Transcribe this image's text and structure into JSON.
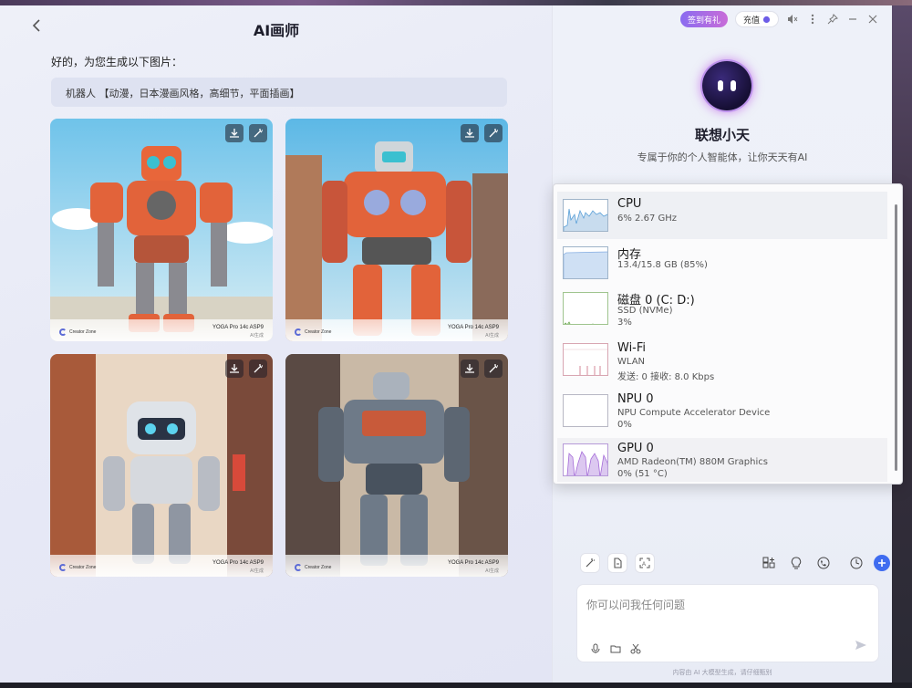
{
  "left": {
    "title": "AI画师",
    "reply": "好的，为您生成以下图片：",
    "prompt": "机器人 【动漫，日本漫画风格，高细节，平面插画】",
    "images": [
      {
        "brand": "Creator Zone",
        "model": "YOGA Pro 14c ASP9",
        "note": "AI生成"
      },
      {
        "brand": "Creator Zone",
        "model": "YOGA Pro 14c ASP9",
        "note": "AI生成"
      },
      {
        "brand": "Creator Zone",
        "model": "YOGA Pro 14c ASP9",
        "note": "AI生成"
      },
      {
        "brand": "Creator Zone",
        "model": "YOGA Pro 14c ASP9",
        "note": "AI生成"
      }
    ]
  },
  "right": {
    "sign_label": "签到有礼",
    "charge_label": "充值",
    "assistant_name": "联想小天",
    "assistant_sub": "专属于你的个人智能体，让你天天有AI",
    "input_placeholder": "你可以问我任何问题",
    "disclaimer": "内容由 AI 大模型生成，请仔细甄别"
  },
  "task_manager": {
    "items": [
      {
        "name": "CPU",
        "line1": "6% 2.67 GHz",
        "line2": ""
      },
      {
        "name": "内存",
        "line1": "13.4/15.8 GB (85%)",
        "line2": ""
      },
      {
        "name": "磁盘 0 (C: D:)",
        "line1": "SSD (NVMe)",
        "line2": "3%"
      },
      {
        "name": "Wi-Fi",
        "line1": "WLAN",
        "line2": "发送: 0 接收: 8.0 Kbps"
      },
      {
        "name": "NPU 0",
        "line1": "NPU Compute Accelerator Device",
        "line2": "0%"
      },
      {
        "name": "GPU 0",
        "line1": "AMD Radeon(TM) 880M Graphics",
        "line2": "0% (51 °C)"
      }
    ]
  },
  "colors": {
    "accent": "#3f6cf0",
    "sign_gradient_start": "#8a6cf0",
    "sign_gradient_end": "#c86cd8",
    "cpu_graph": "#5aa0d8",
    "memory_graph": "#8fb4e4",
    "disk_graph": "#6aa84f",
    "wifi_graph": "#d48a9a",
    "gpu_graph": "#a56cd8"
  }
}
